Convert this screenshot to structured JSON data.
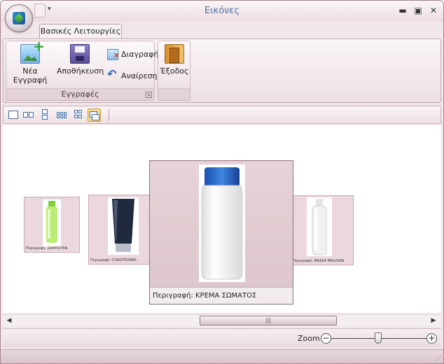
{
  "window": {
    "title": "Εικόνες"
  },
  "ribbon": {
    "tab_label": "Βασικές Λειτουργίες",
    "records_group": {
      "label": "Εγγραφές",
      "new_label": "Νέα Εγγραφή",
      "save_label": "Αποθήκευση",
      "delete_label": "Διαγραφή",
      "undo_label": "Αναίρεση"
    },
    "exit_label": "Έξοδος"
  },
  "carousel": {
    "items": [
      {
        "caption": "Περιγραφή:  ΣΑΜΠΟΥΑΝ",
        "bottle_color": "#9be25a"
      },
      {
        "caption": "Περιγραφή:  CONDITIONER",
        "bottle_color": "#2b3850"
      },
      {
        "caption": "Περιγραφή:  ΚΡΕΜΑ ΣΩΜΑΤΟΣ",
        "bottle_color": "#1e5fc0"
      },
      {
        "caption": "Περιγραφή:  ΜΑΣΚΑ ΜΑΛΛΙΩΝ",
        "bottle_color": "#f3f3f3"
      }
    ]
  },
  "scrollbar": {
    "thumb_grip": "|||"
  },
  "zoom": {
    "label": "Zoom",
    "minus": "−",
    "plus": "+"
  }
}
